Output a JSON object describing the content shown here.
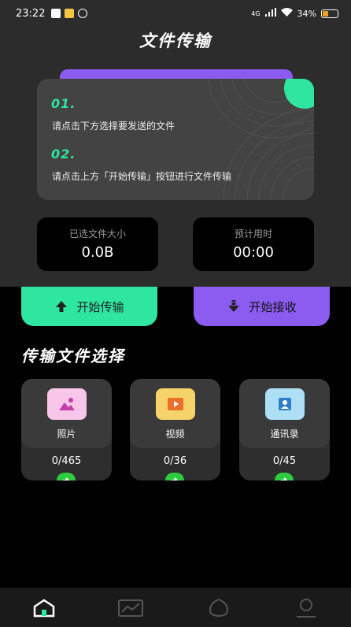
{
  "status": {
    "time": "23:22",
    "network": "4G",
    "battery": "34%"
  },
  "header": {
    "title": "文件传输"
  },
  "instructions": {
    "step1_num": "01.",
    "step1_text": "请点击下方选择要发送的文件",
    "step2_num": "02.",
    "step2_text": "请点击上方「开始传输」按钮进行文件传输"
  },
  "stats": {
    "size_label": "已选文件大小",
    "size_value": "0.0B",
    "time_label": "预计用时",
    "time_value": "00:00"
  },
  "actions": {
    "send_label": "开始传输",
    "receive_label": "开始接收"
  },
  "section": {
    "title": "传输文件选择"
  },
  "file_types": [
    {
      "name": "照片",
      "count": "0/465",
      "icon": "photo-icon"
    },
    {
      "name": "视频",
      "count": "0/36",
      "icon": "video-icon"
    },
    {
      "name": "通讯录",
      "count": "0/45",
      "icon": "contacts-icon"
    }
  ],
  "nav": [
    "home-icon",
    "chart-icon",
    "leaf-icon",
    "profile-icon"
  ],
  "colors": {
    "accent_green": "#2ee6a0",
    "accent_purple": "#8c5cf0",
    "go_green": "#2ecc40"
  }
}
